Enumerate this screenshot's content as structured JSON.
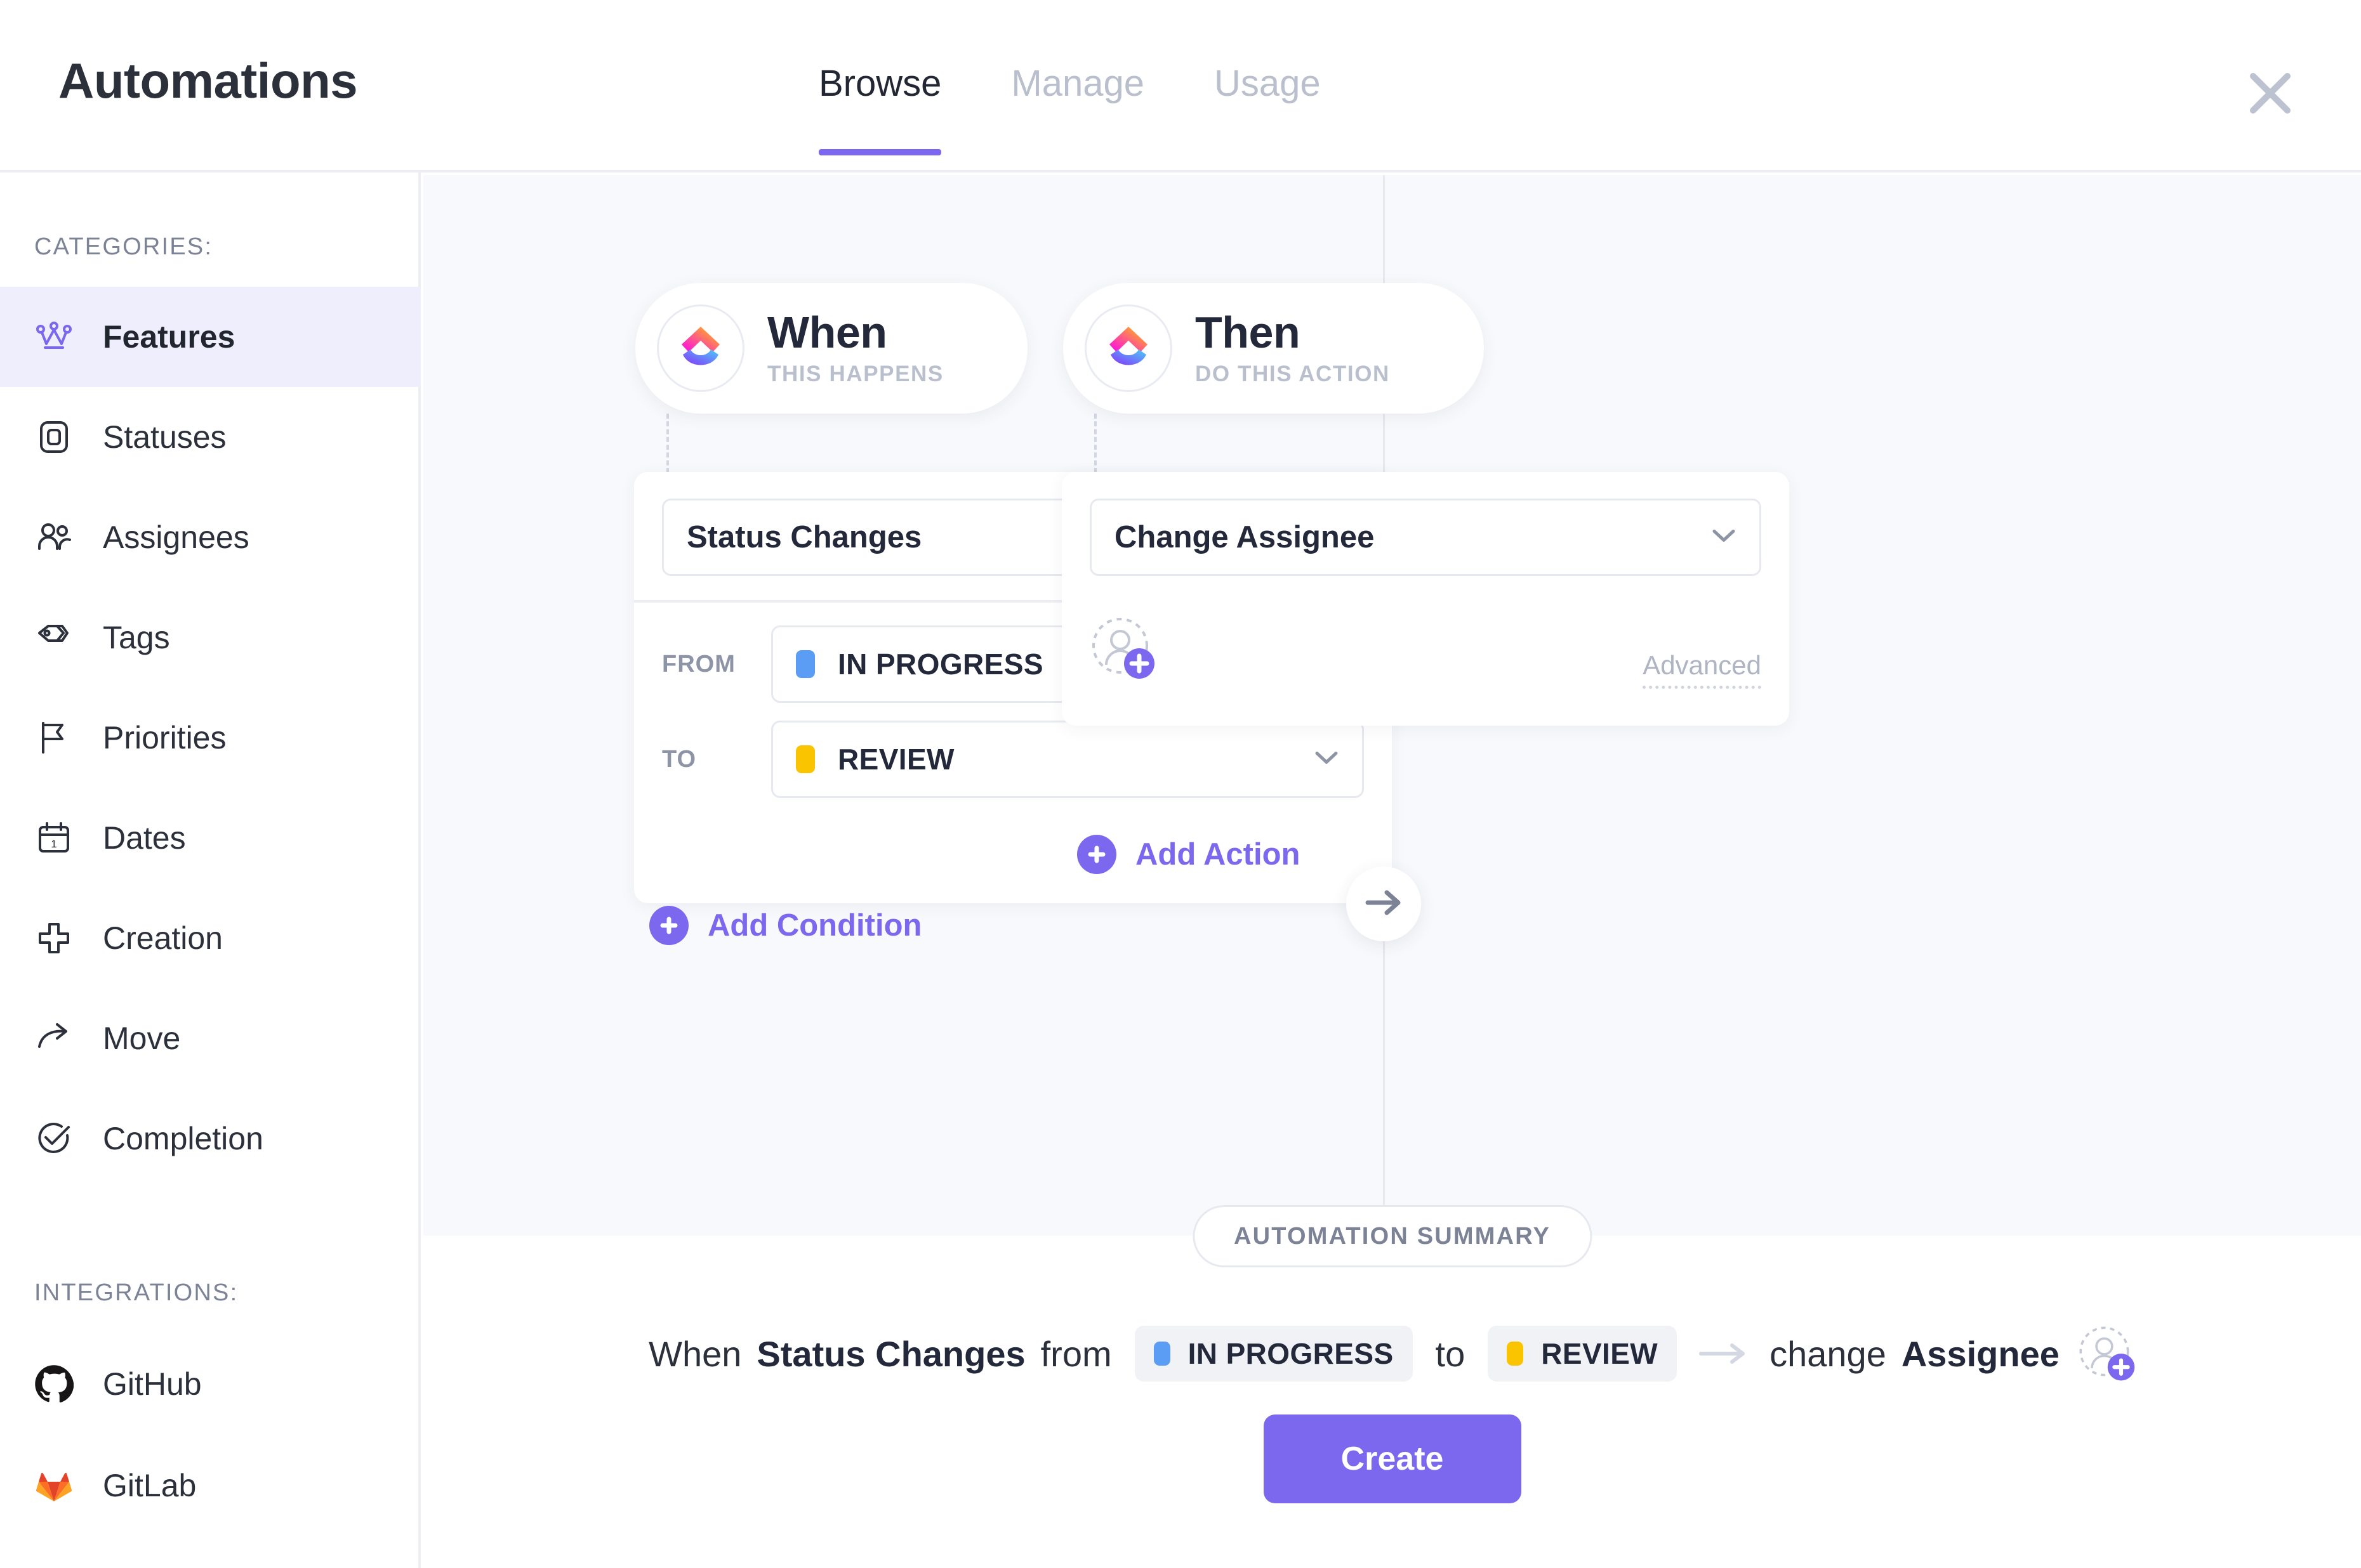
{
  "header": {
    "title": "Automations",
    "close_icon": "close-icon",
    "tabs": [
      {
        "label": "Browse",
        "active": true
      },
      {
        "label": "Manage",
        "active": false
      },
      {
        "label": "Usage",
        "active": false
      }
    ]
  },
  "sidebar": {
    "categories_label": "CATEGORIES:",
    "integrations_label": "INTEGRATIONS:",
    "items": [
      {
        "label": "Features",
        "icon": "crown-icon",
        "active": true
      },
      {
        "label": "Statuses",
        "icon": "status-square-icon",
        "active": false
      },
      {
        "label": "Assignees",
        "icon": "users-icon",
        "active": false
      },
      {
        "label": "Tags",
        "icon": "tag-icon",
        "active": false
      },
      {
        "label": "Priorities",
        "icon": "flag-icon",
        "active": false
      },
      {
        "label": "Dates",
        "icon": "calendar-icon",
        "active": false
      },
      {
        "label": "Creation",
        "icon": "plus-thick-icon",
        "active": false
      },
      {
        "label": "Move",
        "icon": "arrow-curve-icon",
        "active": false
      },
      {
        "label": "Completion",
        "icon": "check-circle-icon",
        "active": false
      }
    ],
    "integrations": [
      {
        "label": "GitHub",
        "icon": "github-icon"
      },
      {
        "label": "GitLab",
        "icon": "gitlab-icon"
      }
    ]
  },
  "builder": {
    "trigger": {
      "title": "When",
      "subtitle": "THIS HAPPENS",
      "logo_icon": "clickup-logo-icon",
      "select_value": "Status Changes",
      "chevron_icon": "chevron-down-icon",
      "from_label": "FROM",
      "from_value": "IN PROGRESS",
      "from_color": "#5b9cf5",
      "to_label": "TO",
      "to_value": "REVIEW",
      "to_color": "#fbc400",
      "add_label": "Add Condition",
      "add_icon": "plus-circle-icon"
    },
    "flow_arrow_icon": "arrow-right-icon",
    "action": {
      "title": "Then",
      "subtitle": "DO THIS ACTION",
      "logo_icon": "clickup-logo-icon",
      "select_value": "Change Assignee",
      "chevron_icon": "chevron-down-icon",
      "avatar_icon": "add-assignee-avatar-icon",
      "advanced_label": "Advanced",
      "add_label": "Add Action",
      "add_icon": "plus-circle-icon"
    }
  },
  "summary": {
    "badge": "AUTOMATION SUMMARY",
    "word_when": "When",
    "trigger_bold": "Status Changes",
    "word_from": "from",
    "from_value": "IN PROGRESS",
    "from_color": "#5b9cf5",
    "word_to": "to",
    "to_value": "REVIEW",
    "to_color": "#fbc400",
    "arrow_icon": "arrow-right-icon",
    "word_change": "change",
    "action_bold": "Assignee",
    "avatar_icon": "add-assignee-avatar-icon",
    "create_label": "Create"
  },
  "colors": {
    "accent_purple": "#7b68ee",
    "canvas_bg": "#f8f9fc",
    "text_dark": "#2b303b",
    "text_muted": "#8d94a6"
  }
}
